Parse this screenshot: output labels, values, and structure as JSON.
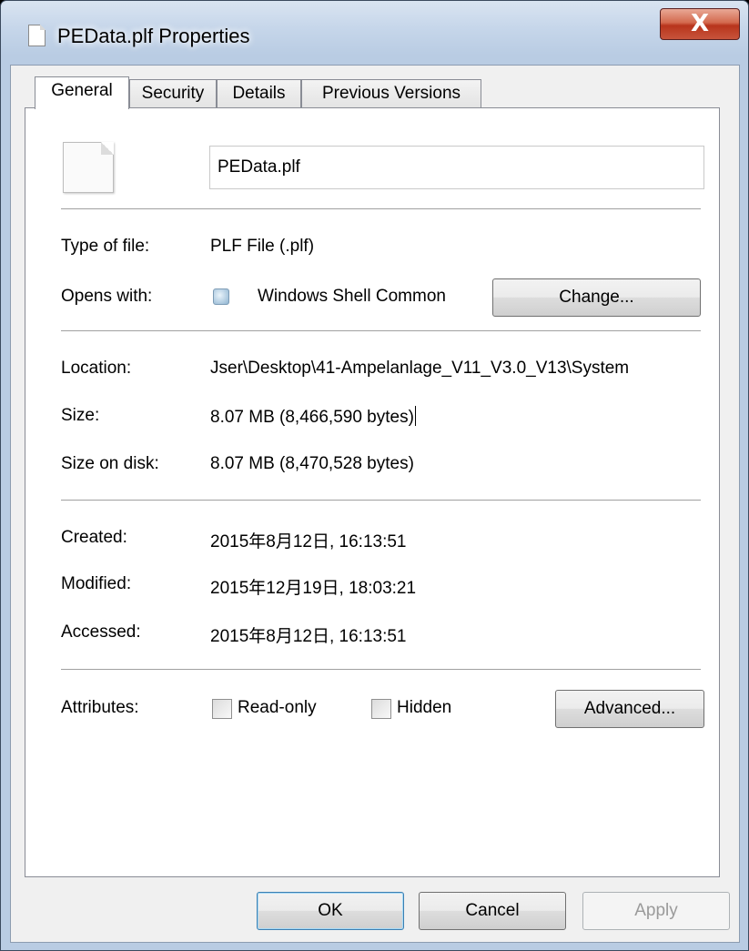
{
  "window": {
    "title": "PEData.plf Properties",
    "close_label": "X"
  },
  "tabs": [
    {
      "label": "General",
      "active": true
    },
    {
      "label": "Security",
      "active": false
    },
    {
      "label": "Details",
      "active": false
    },
    {
      "label": "Previous Versions",
      "active": false
    }
  ],
  "general": {
    "file_name": "PEData.plf",
    "type_label": "Type of file:",
    "type_value": "PLF File (.plf)",
    "opens_label": "Opens with:",
    "opens_value": "Windows Shell Common",
    "change_button": "Change...",
    "location_label": "Location:",
    "location_value": "Jser\\Desktop\\41-Ampelanlage_V11_V3.0_V13\\System",
    "size_label": "Size:",
    "size_value": "8.07 MB (8,466,590 bytes)",
    "size_on_disk_label": "Size on disk:",
    "size_on_disk_value": "8.07 MB (8,470,528 bytes)",
    "created_label": "Created:",
    "created_value": "2015年8月12日, 16:13:51",
    "modified_label": "Modified:",
    "modified_value": "2015年12月19日, 18:03:21",
    "accessed_label": "Accessed:",
    "accessed_value": "2015年8月12日, 16:13:51",
    "attributes_label": "Attributes:",
    "readonly_label": "Read-only",
    "readonly_checked": false,
    "hidden_label": "Hidden",
    "hidden_checked": false,
    "advanced_button": "Advanced..."
  },
  "footer": {
    "ok": "OK",
    "cancel": "Cancel",
    "apply": "Apply"
  }
}
